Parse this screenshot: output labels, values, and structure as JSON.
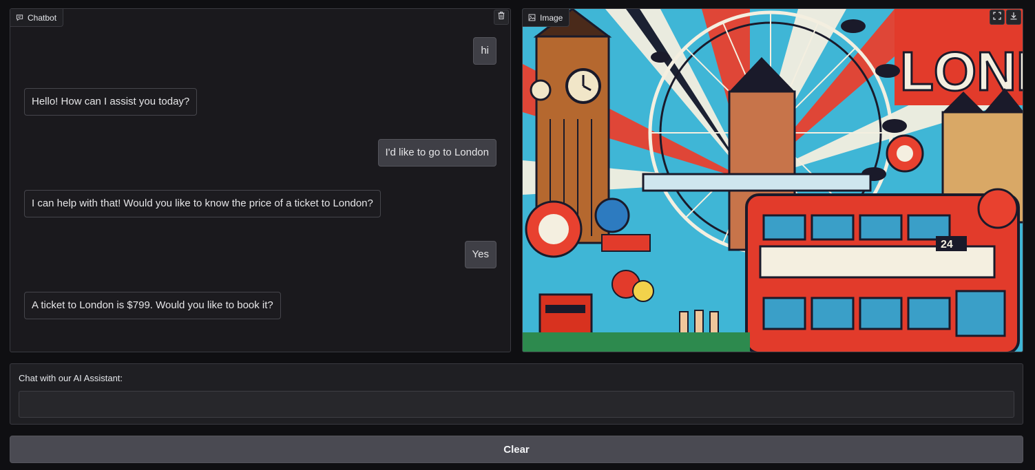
{
  "chatbot": {
    "label": "Chatbot",
    "icon": "chat-bubble-icon",
    "messages": [
      {
        "role": "user",
        "text": "hi"
      },
      {
        "role": "bot",
        "text": "Hello! How can I assist you today?"
      },
      {
        "role": "user",
        "text": "I'd like to go to London"
      },
      {
        "role": "bot",
        "text": "I can help with that! Would you like to know the price of a ticket to London?"
      },
      {
        "role": "user",
        "text": "Yes"
      },
      {
        "role": "bot",
        "text": "A ticket to London is $799. Would you like to book it?"
      }
    ]
  },
  "image": {
    "label": "Image",
    "icon": "image-icon",
    "tools": [
      "fullscreen-icon",
      "download-icon"
    ],
    "sign_text": "LONDON",
    "bus_number": "24"
  },
  "input": {
    "label": "Chat with our AI Assistant:",
    "value": "",
    "placeholder": ""
  },
  "clear_button": {
    "label": "Clear"
  },
  "colors": {
    "background": "#0f0f12",
    "panel": "#1a191d",
    "border": "#3a3a40",
    "user_bubble": "#3f3f46",
    "button": "#4a4a52"
  }
}
